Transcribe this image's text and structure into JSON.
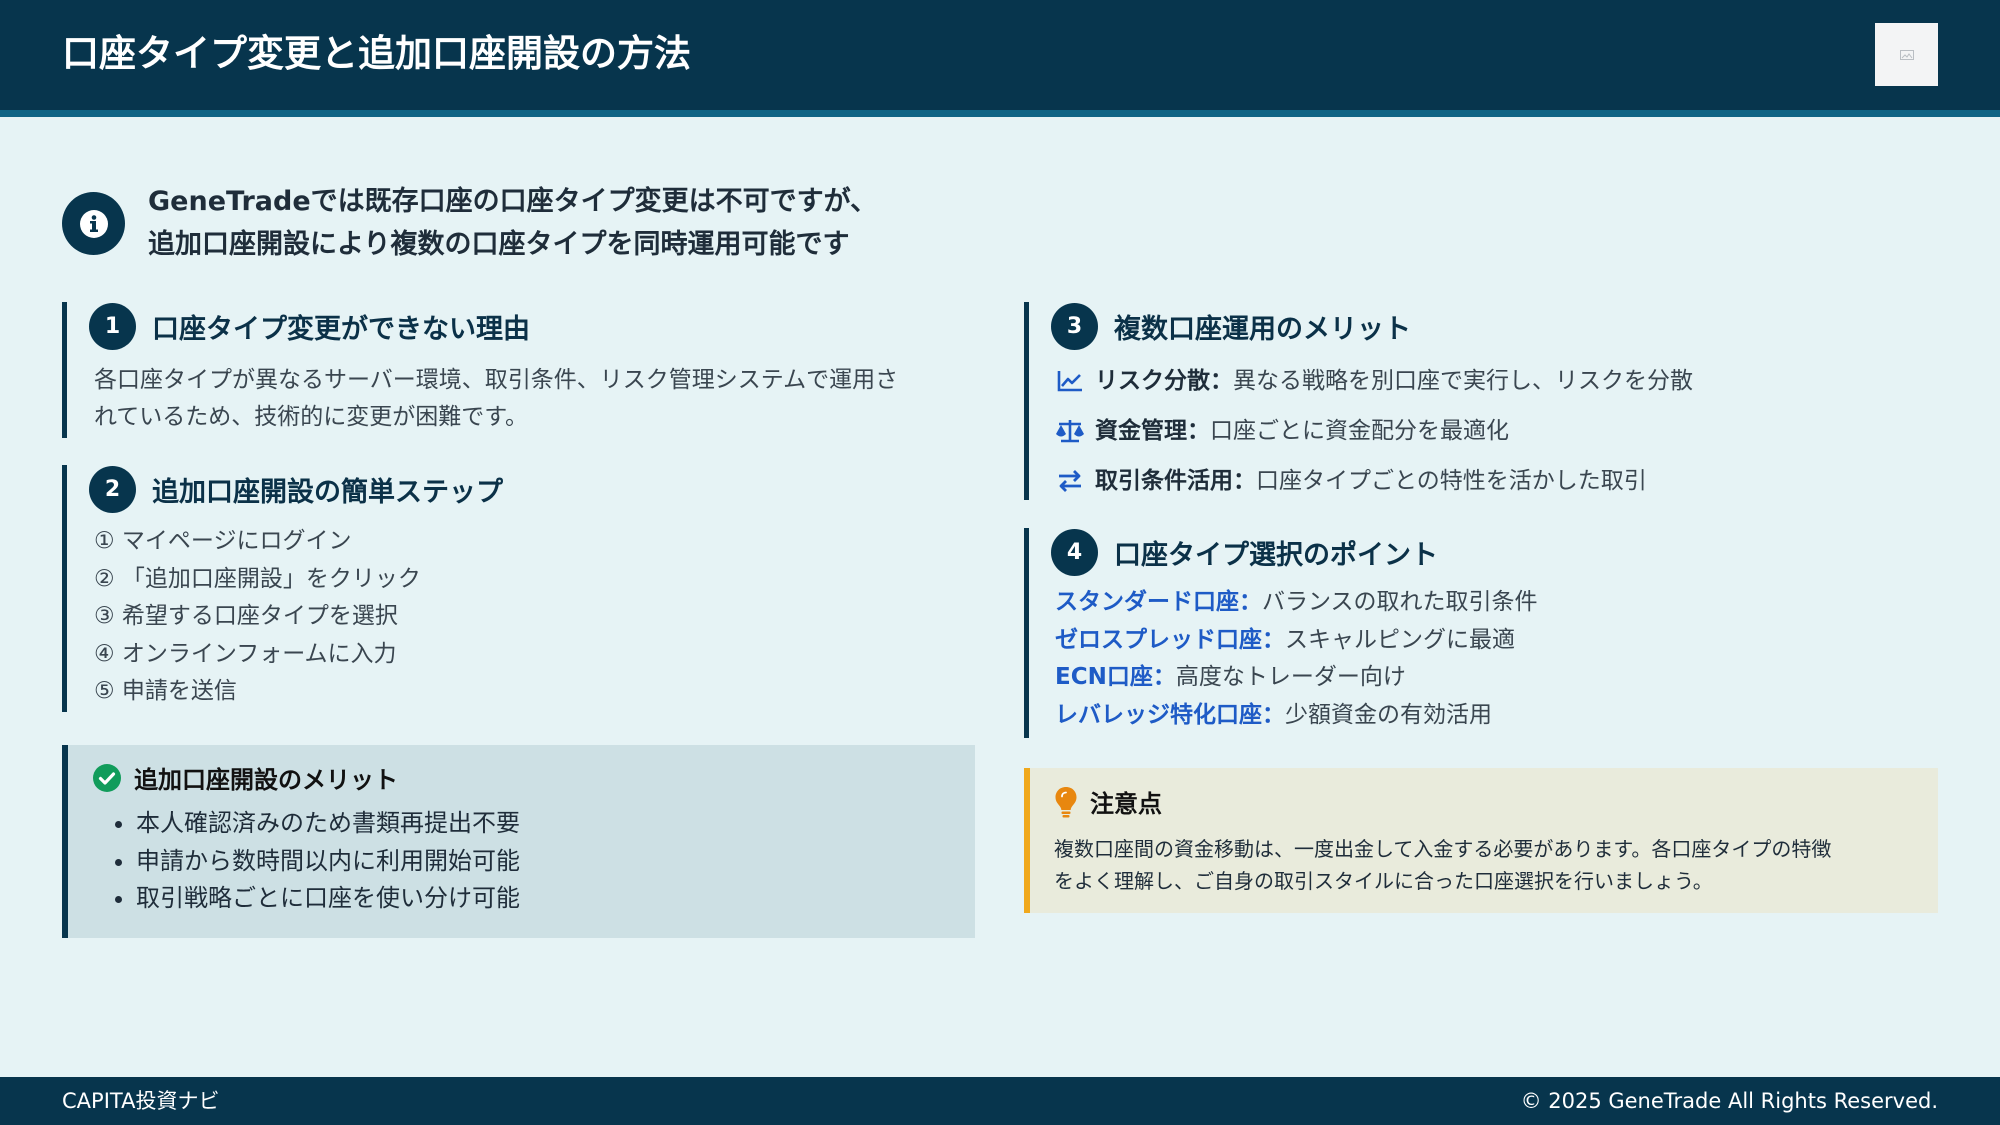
{
  "header": {
    "title": "口座タイプ変更と追加口座開設の方法"
  },
  "intro": {
    "line1": "GeneTradeでは既存口座の口座タイプ変更は不可ですが、",
    "line2": "追加口座開設により複数の口座タイプを同時運用可能です"
  },
  "sections": [
    {
      "number": "1",
      "title": "口座タイプ変更ができない理由",
      "body_line1": "各口座タイプが異なるサーバー環境、取引条件、リスク管理システムで運用さ",
      "body_line2": "れているため、技術的に変更が困難です。"
    },
    {
      "number": "2",
      "title": "追加口座開設の簡単ステップ",
      "steps": [
        "① マイページにログイン",
        "② 「追加口座開設」をクリック",
        "③ 希望する口座タイプを選択",
        "④ オンラインフォームに入力",
        "⑤ 申請を送信"
      ]
    },
    {
      "number": "3",
      "title": "複数口座運用のメリット",
      "items": [
        {
          "icon": "chart-line-icon",
          "label": "リスク分散：",
          "desc": "異なる戦略を別口座で実行し、リスクを分散"
        },
        {
          "icon": "balance-scale-icon",
          "label": "資金管理：",
          "desc": "口座ごとに資金配分を最適化"
        },
        {
          "icon": "exchange-icon",
          "label": "取引条件活用：",
          "desc": "口座タイプごとの特性を活かした取引"
        }
      ]
    },
    {
      "number": "4",
      "title": "口座タイプ選択のポイント",
      "types": [
        {
          "label": "スタンダード口座：",
          "desc": "バランスの取れた取引条件"
        },
        {
          "label": "ゼロスプレッド口座：",
          "desc": "スキャルピングに最適"
        },
        {
          "label": "ECN口座：",
          "desc": "高度なトレーダー向け"
        },
        {
          "label": "レバレッジ特化口座：",
          "desc": "少額資金の有効活用"
        }
      ]
    }
  ],
  "merit_box": {
    "title": "追加口座開設のメリット",
    "items": [
      "本人確認済みのため書類再提出不要",
      "申請から数時間以内に利用開始可能",
      "取引戦略ごとに口座を使い分け可能"
    ]
  },
  "note_box": {
    "title": "注意点",
    "line1": "複数口座間の資金移動は、一度出金して入金する必要があります。各口座タイプの特徴",
    "line2": "をよく理解し、ご自身の取引スタイルに合った口座選択を行いましょう。"
  },
  "footer": {
    "brand": "CAPITA投資ナビ",
    "copyright": "© 2025 GeneTrade All Rights Reserved."
  },
  "colors": {
    "navy": "#07354d",
    "accent_blue": "#1e5bc6",
    "success_green": "#119c5b",
    "warning_orange": "#e8870f",
    "background": "#e6f3f5"
  }
}
